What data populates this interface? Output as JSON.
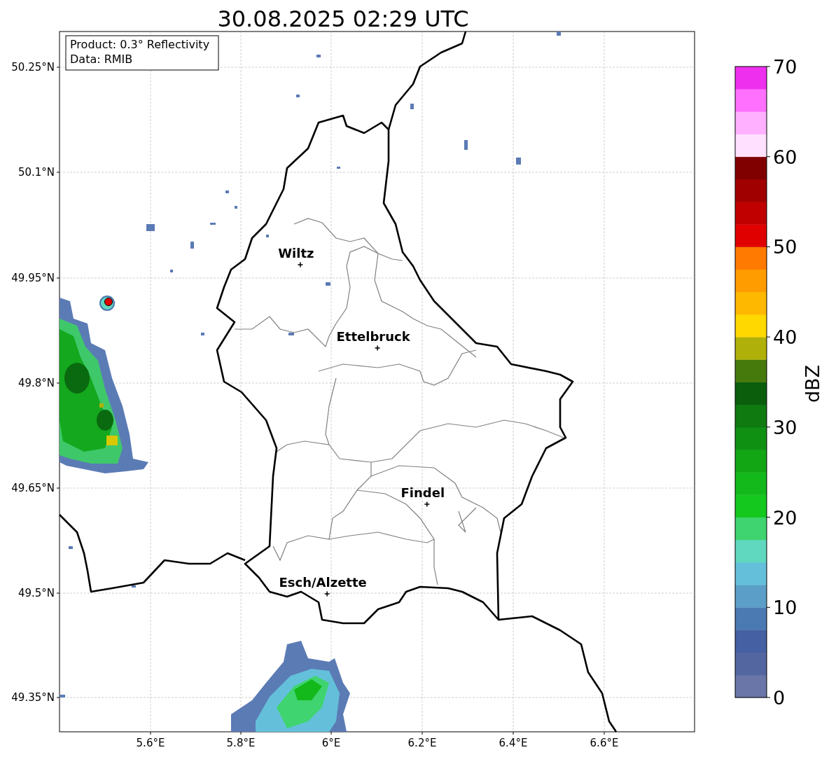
{
  "title": "30.08.2025 02:29 UTC",
  "info_box": [
    "Product: 0.3° Reflectivity",
    "Data: RMIB"
  ],
  "y_ticks": [
    "50.25°N",
    "50.1°N",
    "49.95°N",
    "49.8°N",
    "49.65°N",
    "49.5°N",
    "49.35°N"
  ],
  "x_ticks": [
    "5.6°E",
    "5.8°E",
    "6°E",
    "6.2°E",
    "6.4°E",
    "6.6°E"
  ],
  "cities": [
    {
      "name": "Wiltz"
    },
    {
      "name": "Ettelbruck"
    },
    {
      "name": "Findel"
    },
    {
      "name": "Esch/Alzette"
    }
  ],
  "colorbar": {
    "label": "dBZ",
    "ticks": [
      "70",
      "60",
      "50",
      "40",
      "30",
      "20",
      "10",
      "0"
    ],
    "bands": [
      {
        "color": "#6a76a8"
      },
      {
        "color": "#5366a0"
      },
      {
        "color": "#4560a3"
      },
      {
        "color": "#4b79b1"
      },
      {
        "color": "#5b9ec8"
      },
      {
        "color": "#64c0da"
      },
      {
        "color": "#60d8c0"
      },
      {
        "color": "#3fd46f"
      },
      {
        "color": "#14c81e"
      },
      {
        "color": "#13b81b"
      },
      {
        "color": "#12a615"
      },
      {
        "color": "#109012"
      },
      {
        "color": "#0e7a10"
      },
      {
        "color": "#0a5e0c"
      },
      {
        "color": "#477a0c"
      },
      {
        "color": "#b0b00a"
      },
      {
        "color": "#ffd800"
      },
      {
        "color": "#ffb800"
      },
      {
        "color": "#ff9c00"
      },
      {
        "color": "#ff7a00"
      },
      {
        "color": "#e00000"
      },
      {
        "color": "#c00000"
      },
      {
        "color": "#a00000"
      },
      {
        "color": "#800000"
      },
      {
        "color": "#ffe0ff"
      },
      {
        "color": "#ffb0ff"
      },
      {
        "color": "#ff70ff"
      },
      {
        "color": "#ee30ee"
      }
    ]
  }
}
